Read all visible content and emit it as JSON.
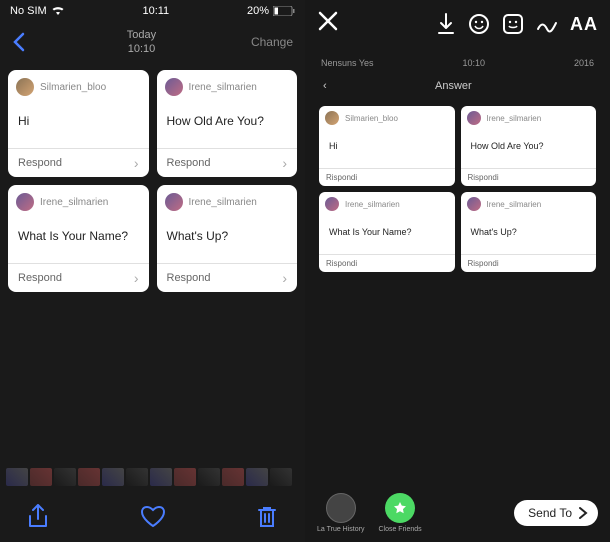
{
  "left": {
    "status": {
      "carrier": "No SIM",
      "time": "10:11",
      "battery": "20%"
    },
    "nav": {
      "today": "Today",
      "subtime": "10:10",
      "change": "Change"
    },
    "cards": [
      {
        "user": "Silmarien_bloo",
        "question": "Hi",
        "respond": "Respond"
      },
      {
        "user": "Irene_silmarien",
        "question": "How Old Are You?",
        "respond": "Respond"
      },
      {
        "user": "Irene_silmarien",
        "question": "What Is Your Name?",
        "respond": "Respond"
      },
      {
        "user": "Irene_silmarien",
        "question": "What's Up?",
        "respond": "Respond"
      }
    ]
  },
  "right": {
    "inner_status": {
      "carrier": "Nensuns Yes",
      "time": "10:10",
      "battery": "2016"
    },
    "inner_nav_title": "Answer",
    "cards": [
      {
        "user": "Silmarien_bloo",
        "question": "Hi",
        "respond": "Rispondi"
      },
      {
        "user": "Irene_silmarien",
        "question": "How Old Are You?",
        "respond": "Rispondi"
      },
      {
        "user": "Irene_silmarien",
        "question": "What Is Your Name?",
        "respond": "Rispondi"
      },
      {
        "user": "Irene_silmarien",
        "question": "What's Up?",
        "respond": "Rispondi"
      }
    ],
    "bottom": {
      "history": "La True History",
      "close_friends": "Close Friends",
      "send_to": "Send To"
    }
  }
}
